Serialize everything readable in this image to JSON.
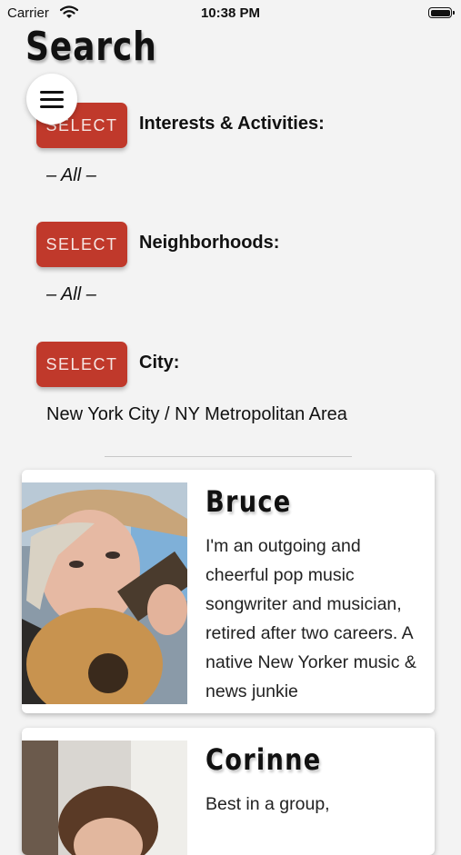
{
  "status_bar": {
    "carrier": "Carrier",
    "time": "10:38 PM"
  },
  "page": {
    "title": "Search"
  },
  "filters": [
    {
      "button_label": "SELECT",
      "label": "Interests & Activities:",
      "value": "– All –"
    },
    {
      "button_label": "SELECT",
      "label": "Neighborhoods:",
      "value": "– All –"
    },
    {
      "button_label": "SELECT",
      "label": "City:",
      "value": "New York City / NY Metropolitan Area"
    }
  ],
  "profiles": [
    {
      "name": "Bruce",
      "bio": "I'm an outgoing and cheerful pop music songwriter and musician, retired after two careers. A native New Yorker music & news junkie"
    },
    {
      "name": "Corinne",
      "bio": "Best in a group,"
    }
  ],
  "colors": {
    "accent": "#c0392b",
    "background": "#f3f3f3",
    "card": "#ffffff"
  }
}
